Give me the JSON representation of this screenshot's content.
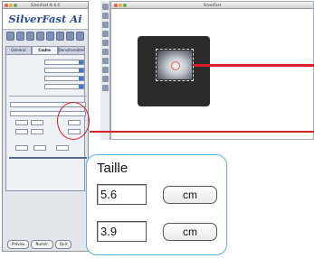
{
  "panel": {
    "title": "SilverFast Ai 6.0",
    "logo": "SilverFast Ai",
    "tabs": [
      "Général",
      "Cadre",
      "Densitomètre"
    ],
    "bottom_buttons": [
      "Prévisu",
      "Numér.",
      "Quit"
    ]
  },
  "preview": {
    "title": "SilverFast"
  },
  "zoom": {
    "label": "Taille",
    "width_value": "5.6",
    "height_value": "3.9",
    "width_unit": "cm",
    "height_unit": "cm"
  },
  "colors": {
    "highlight": "#d8202a",
    "callout_border": "#5ab3e0",
    "logo": "#2b4a9a"
  }
}
